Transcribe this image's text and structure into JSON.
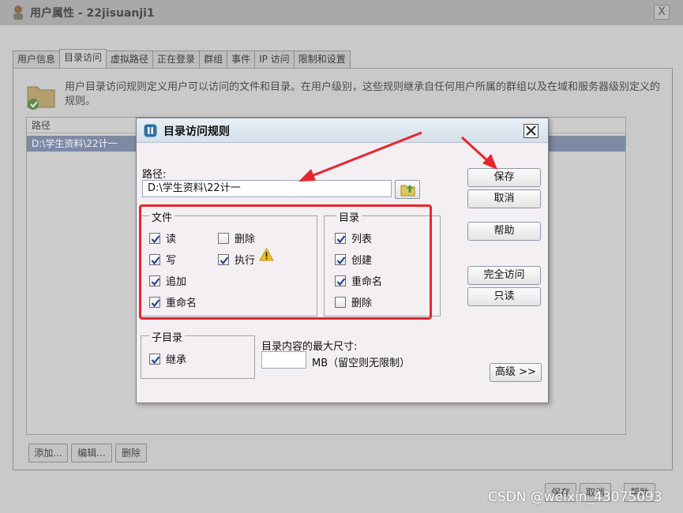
{
  "background_window": {
    "title": "用户属性 - 22jisuanji1",
    "close_label": "X",
    "tabs": [
      "用户信息",
      "目录访问",
      "虚拟路径",
      "正在登录",
      "群组",
      "事件",
      "IP 访问",
      "限制和设置"
    ],
    "description": "用户目录访问规则定义用户可以访问的文件和目录。在用户级别，这些规则继承自任何用户所属的群组以及在域和服务器级别定义的规则。",
    "list_header": "路径",
    "list_rows": [
      "D:\\学生资料\\22计一"
    ],
    "buttons": {
      "add": "添加...",
      "edit": "编辑...",
      "delete": "删除"
    },
    "footer_buttons": [
      "保存",
      "取消",
      "帮助"
    ]
  },
  "dialog": {
    "title": "目录访问规则",
    "path_label": "路径:",
    "path_value": "D:\\学生资料\\22计一",
    "files": {
      "legend": "文件",
      "items": [
        {
          "label": "读",
          "checked": true
        },
        {
          "label": "写",
          "checked": true
        },
        {
          "label": "追加",
          "checked": true
        },
        {
          "label": "重命名",
          "checked": true
        },
        {
          "label": "删除",
          "checked": false
        },
        {
          "label": "执行",
          "checked": true
        }
      ]
    },
    "directories": {
      "legend": "目录",
      "items": [
        {
          "label": "列表",
          "checked": true
        },
        {
          "label": "创建",
          "checked": true
        },
        {
          "label": "重命名",
          "checked": true
        },
        {
          "label": "删除",
          "checked": false
        }
      ]
    },
    "subdirectories": {
      "legend": "子目录",
      "items": [
        {
          "label": "继承",
          "checked": true
        }
      ]
    },
    "max_size_label": "目录内容的最大尺寸:",
    "max_size_value": "",
    "max_size_unit": "MB（留空则无限制）",
    "buttons": {
      "save": "保存",
      "cancel": "取消",
      "help": "帮助",
      "full_access": "完全访问",
      "read_only": "只读",
      "advanced": "高级 >>"
    }
  },
  "watermark": "CSDN @weixin_43075093",
  "colors": {
    "annotation_red": "#e8262d",
    "selected_row": "#7c8aa4"
  }
}
